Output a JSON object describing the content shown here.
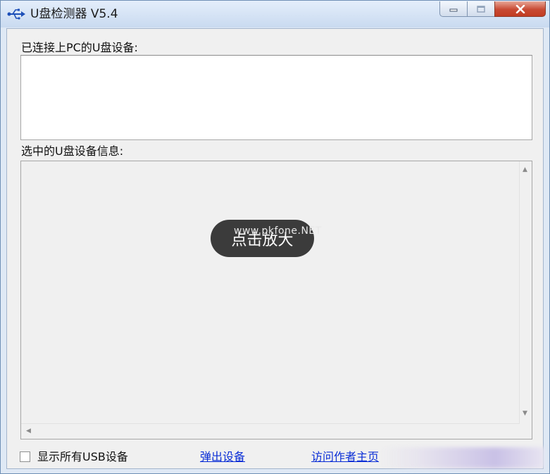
{
  "window": {
    "title": "U盘检测器 V5.4",
    "icon": "usb-icon",
    "controls": {
      "minimize": "minimize-icon",
      "maximize": "maximize-icon",
      "close": "close-icon"
    }
  },
  "connected_devices": {
    "label": "已连接上PC的U盘设备:",
    "items": []
  },
  "selected_info": {
    "label": "选中的U盘设备信息:",
    "content": ""
  },
  "overlay": {
    "zoom_label": "点击放大",
    "watermark": "www.pkfone.NET"
  },
  "footer": {
    "show_all_label": "显示所有USB设备",
    "show_all_checked": false,
    "eject_link": "弹出设备",
    "home_link": "访问作者主页"
  },
  "colors": {
    "link": "#0a2ed6",
    "close_button": "#c84a33",
    "badge": "#3b3b3b"
  }
}
